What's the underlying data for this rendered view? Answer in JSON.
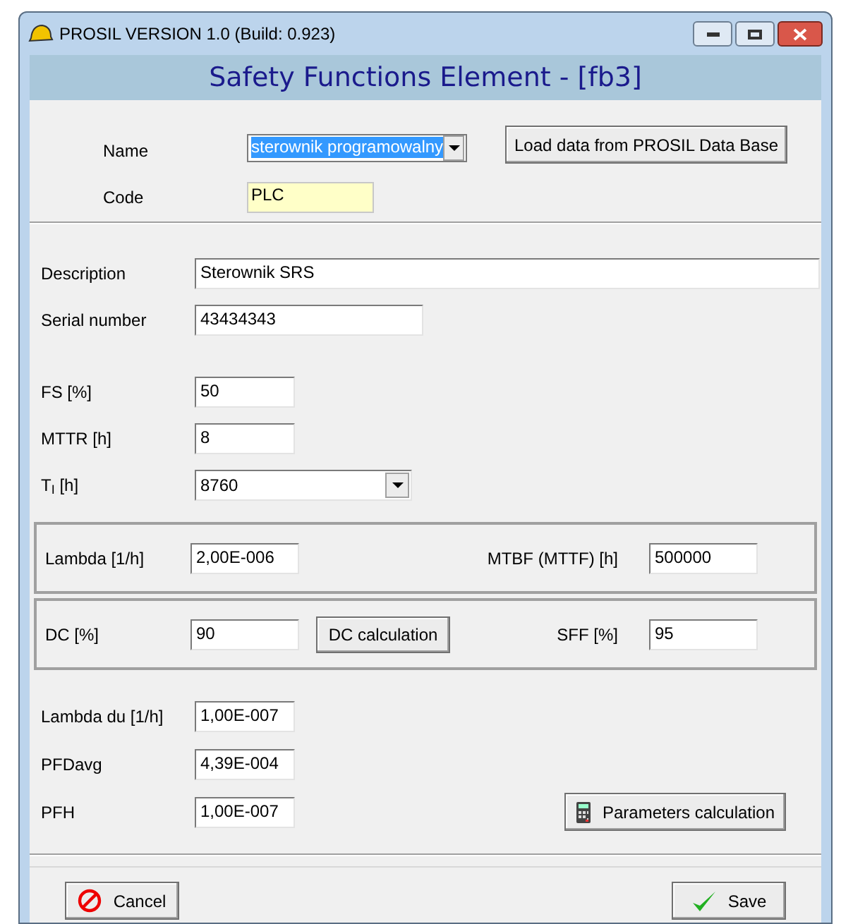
{
  "window": {
    "title": "PROSIL VERSION 1.0 (Build: 0.923)",
    "heading": "Safety Functions Element - [fb3]"
  },
  "top": {
    "name_label": "Name",
    "name_value": "sterownik programowalny",
    "load_button": "Load data from PROSIL Data Base",
    "code_label": "Code",
    "code_value": "PLC"
  },
  "fields": [
    {
      "label": "Description",
      "value": "Sterownik SRS",
      "kind": "wide"
    },
    {
      "label": "Serial number",
      "value": "43434343",
      "kind": "medium"
    },
    {
      "label": "FS [%]",
      "value": "50",
      "kind": "short"
    },
    {
      "label": "MTTR [h]",
      "value": "8",
      "kind": "short"
    },
    {
      "label": "T$_{I}$ [h]",
      "value": "8760",
      "kind": "combo"
    }
  ],
  "group1": {
    "left_label": "Lambda [1/h]",
    "left_value": "2,00E-006",
    "right_label": "MTBF (MTTF) [h]",
    "right_value": "500000"
  },
  "group2": {
    "left_label": "DC [%]",
    "left_value": "90",
    "button": "DC calculation",
    "right_label": "SFF [%]",
    "right_value": "95"
  },
  "results": [
    {
      "label": "Lambda du [1/h]",
      "value": "1,00E-007"
    },
    {
      "label": "PFDavg",
      "value": "4,39E-004"
    },
    {
      "label": "PFH",
      "value": "1,00E-007"
    }
  ],
  "calc_button": "Parameters calculation",
  "buttons": {
    "cancel": "Cancel",
    "save": "Save"
  }
}
